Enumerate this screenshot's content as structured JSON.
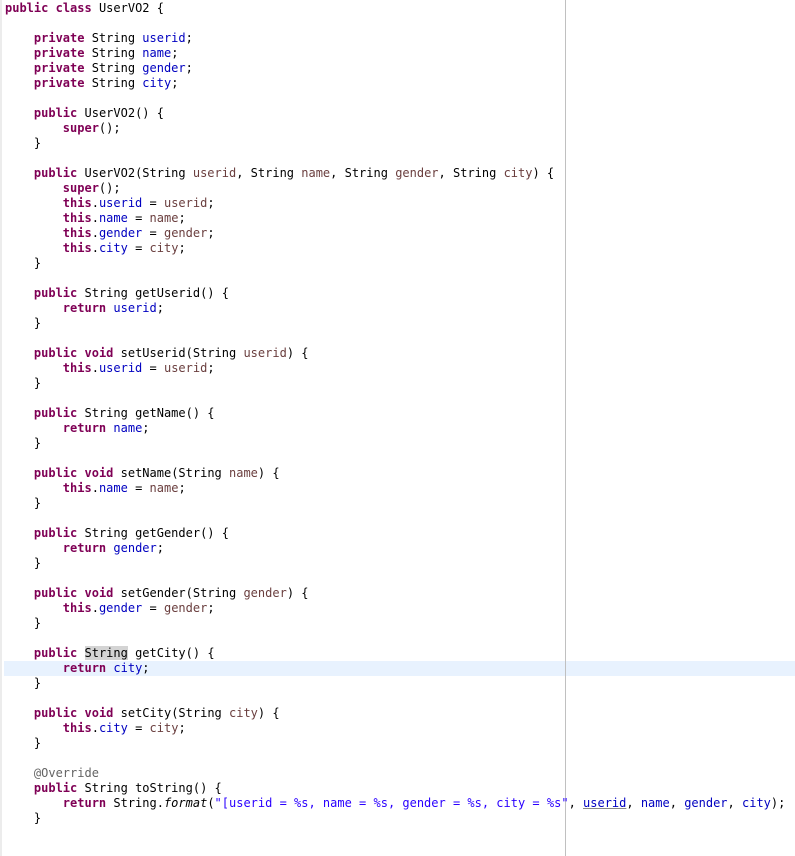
{
  "class_name": "UserVO2",
  "fields": [
    {
      "type": "String",
      "name": "userid"
    },
    {
      "type": "String",
      "name": "name"
    },
    {
      "type": "String",
      "name": "gender"
    },
    {
      "type": "String",
      "name": "city"
    }
  ],
  "colors": {
    "keyword": "#7f0055",
    "field": "#0000c0",
    "parameter": "#6a3e3e",
    "string": "#2a00ff",
    "annotation": "#646464",
    "current_line": "#e8f2fe",
    "occurrence_highlight": "#d4d4d4"
  },
  "code_lines": [
    [
      [
        "kw",
        "public"
      ],
      [
        "t",
        " "
      ],
      [
        "kw",
        "class"
      ],
      [
        "t",
        " UserVO2 {"
      ]
    ],
    [],
    [
      [
        "t",
        "    "
      ],
      [
        "kw",
        "private"
      ],
      [
        "t",
        " String "
      ],
      [
        "fld",
        "userid"
      ],
      [
        "t",
        ";"
      ]
    ],
    [
      [
        "t",
        "    "
      ],
      [
        "kw",
        "private"
      ],
      [
        "t",
        " String "
      ],
      [
        "fld",
        "name"
      ],
      [
        "t",
        ";"
      ]
    ],
    [
      [
        "t",
        "    "
      ],
      [
        "kw",
        "private"
      ],
      [
        "t",
        " String "
      ],
      [
        "fld",
        "gender"
      ],
      [
        "t",
        ";"
      ]
    ],
    [
      [
        "t",
        "    "
      ],
      [
        "kw",
        "private"
      ],
      [
        "t",
        " String "
      ],
      [
        "fld",
        "city"
      ],
      [
        "t",
        ";"
      ]
    ],
    [],
    [
      [
        "t",
        "    "
      ],
      [
        "kw",
        "public"
      ],
      [
        "t",
        " UserVO2() {"
      ]
    ],
    [
      [
        "t",
        "        "
      ],
      [
        "kw",
        "super"
      ],
      [
        "t",
        "();"
      ]
    ],
    [
      [
        "t",
        "    }"
      ]
    ],
    [],
    [
      [
        "t",
        "    "
      ],
      [
        "kw",
        "public"
      ],
      [
        "t",
        " UserVO2(String "
      ],
      [
        "prm",
        "userid"
      ],
      [
        "t",
        ", String "
      ],
      [
        "prm",
        "name"
      ],
      [
        "t",
        ", String "
      ],
      [
        "prm",
        "gender"
      ],
      [
        "t",
        ", String "
      ],
      [
        "prm",
        "city"
      ],
      [
        "t",
        ") {"
      ]
    ],
    [
      [
        "t",
        "        "
      ],
      [
        "kw",
        "super"
      ],
      [
        "t",
        "();"
      ]
    ],
    [
      [
        "t",
        "        "
      ],
      [
        "kw",
        "this"
      ],
      [
        "t",
        "."
      ],
      [
        "fld",
        "userid"
      ],
      [
        "t",
        " = "
      ],
      [
        "prm",
        "userid"
      ],
      [
        "t",
        ";"
      ]
    ],
    [
      [
        "t",
        "        "
      ],
      [
        "kw",
        "this"
      ],
      [
        "t",
        "."
      ],
      [
        "fld",
        "name"
      ],
      [
        "t",
        " = "
      ],
      [
        "prm",
        "name"
      ],
      [
        "t",
        ";"
      ]
    ],
    [
      [
        "t",
        "        "
      ],
      [
        "kw",
        "this"
      ],
      [
        "t",
        "."
      ],
      [
        "fld",
        "gender"
      ],
      [
        "t",
        " = "
      ],
      [
        "prm",
        "gender"
      ],
      [
        "t",
        ";"
      ]
    ],
    [
      [
        "t",
        "        "
      ],
      [
        "kw",
        "this"
      ],
      [
        "t",
        "."
      ],
      [
        "fld",
        "city"
      ],
      [
        "t",
        " = "
      ],
      [
        "prm",
        "city"
      ],
      [
        "t",
        ";"
      ]
    ],
    [
      [
        "t",
        "    }"
      ]
    ],
    [],
    [
      [
        "t",
        "    "
      ],
      [
        "kw",
        "public"
      ],
      [
        "t",
        " String getUserid() {"
      ]
    ],
    [
      [
        "t",
        "        "
      ],
      [
        "kw",
        "return"
      ],
      [
        "t",
        " "
      ],
      [
        "fld",
        "userid"
      ],
      [
        "t",
        ";"
      ]
    ],
    [
      [
        "t",
        "    }"
      ]
    ],
    [],
    [
      [
        "t",
        "    "
      ],
      [
        "kw",
        "public"
      ],
      [
        "t",
        " "
      ],
      [
        "kw",
        "void"
      ],
      [
        "t",
        " setUserid(String "
      ],
      [
        "prm",
        "userid"
      ],
      [
        "t",
        ") {"
      ]
    ],
    [
      [
        "t",
        "        "
      ],
      [
        "kw",
        "this"
      ],
      [
        "t",
        "."
      ],
      [
        "fld",
        "userid"
      ],
      [
        "t",
        " = "
      ],
      [
        "prm",
        "userid"
      ],
      [
        "t",
        ";"
      ]
    ],
    [
      [
        "t",
        "    }"
      ]
    ],
    [],
    [
      [
        "t",
        "    "
      ],
      [
        "kw",
        "public"
      ],
      [
        "t",
        " String getName() {"
      ]
    ],
    [
      [
        "t",
        "        "
      ],
      [
        "kw",
        "return"
      ],
      [
        "t",
        " "
      ],
      [
        "fld",
        "name"
      ],
      [
        "t",
        ";"
      ]
    ],
    [
      [
        "t",
        "    }"
      ]
    ],
    [],
    [
      [
        "t",
        "    "
      ],
      [
        "kw",
        "public"
      ],
      [
        "t",
        " "
      ],
      [
        "kw",
        "void"
      ],
      [
        "t",
        " setName(String "
      ],
      [
        "prm",
        "name"
      ],
      [
        "t",
        ") {"
      ]
    ],
    [
      [
        "t",
        "        "
      ],
      [
        "kw",
        "this"
      ],
      [
        "t",
        "."
      ],
      [
        "fld",
        "name"
      ],
      [
        "t",
        " = "
      ],
      [
        "prm",
        "name"
      ],
      [
        "t",
        ";"
      ]
    ],
    [
      [
        "t",
        "    }"
      ]
    ],
    [],
    [
      [
        "t",
        "    "
      ],
      [
        "kw",
        "public"
      ],
      [
        "t",
        " String getGender() {"
      ]
    ],
    [
      [
        "t",
        "        "
      ],
      [
        "kw",
        "return"
      ],
      [
        "t",
        " "
      ],
      [
        "fld",
        "gender"
      ],
      [
        "t",
        ";"
      ]
    ],
    [
      [
        "t",
        "    }"
      ]
    ],
    [],
    [
      [
        "t",
        "    "
      ],
      [
        "kw",
        "public"
      ],
      [
        "t",
        " "
      ],
      [
        "kw",
        "void"
      ],
      [
        "t",
        " setGender(String "
      ],
      [
        "prm",
        "gender"
      ],
      [
        "t",
        ") {"
      ]
    ],
    [
      [
        "t",
        "        "
      ],
      [
        "kw",
        "this"
      ],
      [
        "t",
        "."
      ],
      [
        "fld",
        "gender"
      ],
      [
        "t",
        " = "
      ],
      [
        "prm",
        "gender"
      ],
      [
        "t",
        ";"
      ]
    ],
    [
      [
        "t",
        "    }"
      ]
    ],
    [],
    [
      [
        "t",
        "    "
      ],
      [
        "kw",
        "public"
      ],
      [
        "t",
        " "
      ],
      [
        "hl",
        "String"
      ],
      [
        "t",
        " getCity() {"
      ]
    ],
    [
      [
        "t",
        "        "
      ],
      [
        "kw",
        "return"
      ],
      [
        "t",
        " "
      ],
      [
        "fld",
        "city"
      ],
      [
        "t",
        ";"
      ]
    ],
    [
      [
        "t",
        "    }"
      ]
    ],
    [],
    [
      [
        "t",
        "    "
      ],
      [
        "kw",
        "public"
      ],
      [
        "t",
        " "
      ],
      [
        "kw",
        "void"
      ],
      [
        "t",
        " setCity(String "
      ],
      [
        "prm",
        "city"
      ],
      [
        "t",
        ") {"
      ]
    ],
    [
      [
        "t",
        "        "
      ],
      [
        "kw",
        "this"
      ],
      [
        "t",
        "."
      ],
      [
        "fld",
        "city"
      ],
      [
        "t",
        " = "
      ],
      [
        "prm",
        "city"
      ],
      [
        "t",
        ";"
      ]
    ],
    [
      [
        "t",
        "    }"
      ]
    ],
    [],
    [
      [
        "t",
        "    "
      ],
      [
        "ann",
        "@Override"
      ]
    ],
    [
      [
        "t",
        "    "
      ],
      [
        "kw",
        "public"
      ],
      [
        "t",
        " String toString() {"
      ]
    ],
    [
      [
        "t",
        "        "
      ],
      [
        "kw",
        "return"
      ],
      [
        "t",
        " String."
      ],
      [
        "it",
        "format"
      ],
      [
        "t",
        "("
      ],
      [
        "str",
        "\"[userid = %s, name = %s, gender = %s, city = %s\""
      ],
      [
        "t",
        ", "
      ],
      [
        "fldu",
        "userid"
      ],
      [
        "t",
        ", "
      ],
      [
        "fld",
        "name"
      ],
      [
        "t",
        ", "
      ],
      [
        "fld",
        "gender"
      ],
      [
        "t",
        ", "
      ],
      [
        "fld",
        "city"
      ],
      [
        "t",
        ");"
      ]
    ],
    [
      [
        "t",
        "    }"
      ]
    ]
  ]
}
